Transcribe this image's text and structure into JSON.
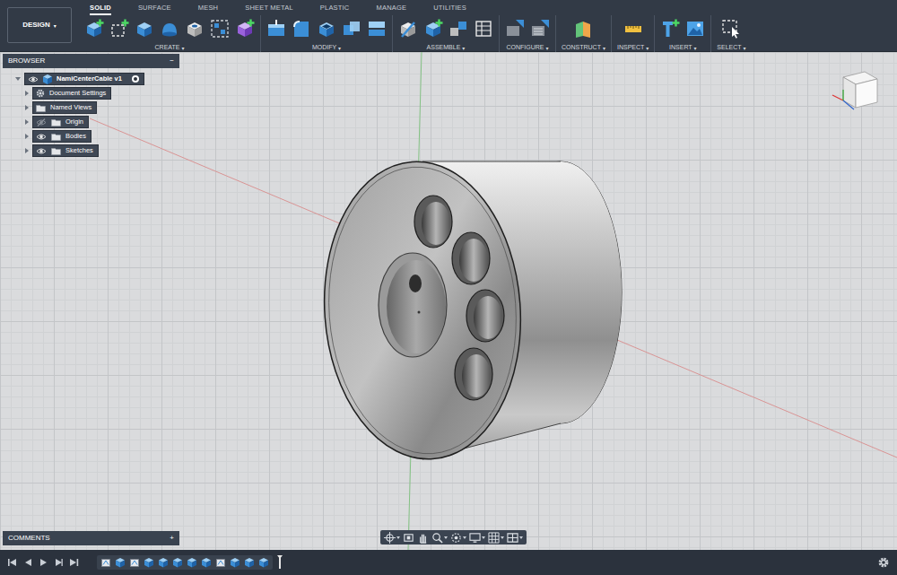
{
  "workspace": {
    "label": "DESIGN",
    "caret": "▾"
  },
  "tabs": [
    {
      "label": "SOLID",
      "selected": true
    },
    {
      "label": "SURFACE",
      "selected": false
    },
    {
      "label": "MESH",
      "selected": false
    },
    {
      "label": "SHEET METAL",
      "selected": false
    },
    {
      "label": "PLASTIC",
      "selected": false
    },
    {
      "label": "MANAGE",
      "selected": false
    },
    {
      "label": "UTILITIES",
      "selected": false
    }
  ],
  "groups": [
    {
      "label": "CREATE",
      "caret": "▾"
    },
    {
      "label": "MODIFY",
      "caret": "▾"
    },
    {
      "label": "ASSEMBLE",
      "caret": "▾"
    },
    {
      "label": "CONFIGURE",
      "caret": "▾"
    },
    {
      "label": "CONSTRUCT",
      "caret": "▾"
    },
    {
      "label": "INSPECT",
      "caret": "▾"
    },
    {
      "label": "INSERT",
      "caret": "▾"
    },
    {
      "label": "SELECT",
      "caret": "▾"
    }
  ],
  "browser": {
    "title": "BROWSER",
    "collapse": "−",
    "items": [
      {
        "label": "NamiCenterCable v1",
        "kind": "root",
        "expanded": true,
        "visible": true,
        "active": true
      },
      {
        "label": "Document Settings",
        "kind": "settings",
        "expanded": false
      },
      {
        "label": "Named Views",
        "kind": "views",
        "expanded": false
      },
      {
        "label": "Origin",
        "kind": "folder",
        "expanded": false,
        "visible": false
      },
      {
        "label": "Bodies",
        "kind": "folder",
        "expanded": false,
        "visible": true
      },
      {
        "label": "Sketches",
        "kind": "folder",
        "expanded": false,
        "visible": true
      }
    ]
  },
  "comments": {
    "title": "COMMENTS",
    "add": "+"
  },
  "timeline": {
    "features": [
      {
        "kind": "sketch"
      },
      {
        "kind": "extrude"
      },
      {
        "kind": "sketch"
      },
      {
        "kind": "extrude"
      },
      {
        "kind": "extrude"
      },
      {
        "kind": "extrude"
      },
      {
        "kind": "extrude"
      },
      {
        "kind": "extrude"
      },
      {
        "kind": "sketch"
      },
      {
        "kind": "extrude"
      },
      {
        "kind": "extrude"
      },
      {
        "kind": "extrude"
      }
    ]
  }
}
